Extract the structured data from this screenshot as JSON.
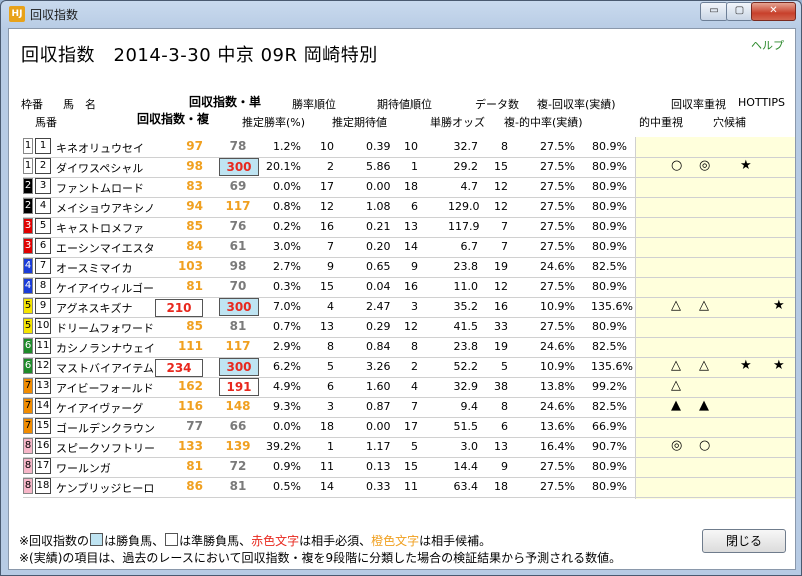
{
  "window": {
    "title": "回収指数",
    "icon_text": "HJ",
    "min": "▭",
    "max": "▢",
    "close": "✕"
  },
  "main": {
    "title": "回収指数　2014-3-30 中京 09R 岡崎特別",
    "help": "ヘルプ"
  },
  "headers_top": {
    "waku_label": "枠番",
    "horse_label": "馬　名",
    "index_single": "回収指数・単",
    "win_rank": "勝率順位",
    "exp_rank": "期待値順位",
    "data_count": "データ数",
    "place_recovery": "複-回収率(実績)",
    "recovery_focus": "回収率重視",
    "hottips": "HOTTIPS"
  },
  "headers_bottom": {
    "umaban": "馬番",
    "index_double": "回収指数・複",
    "est_win": "推定勝率(%)",
    "est_exp": "推定期待値",
    "win_odds": "単勝オッズ",
    "place_hit": "複-的中率(実績)",
    "hit_focus": "的中重視",
    "longshot": "穴候補"
  },
  "colors": {
    "orange": "#f0a020",
    "red": "#e8281e",
    "gray": "#7a7a7a",
    "cyan": "#bfe4f2"
  },
  "rows": [
    {
      "waku": "1",
      "waku_bg": "#ffffff",
      "waku_fg": "#000",
      "uma": "1",
      "name": "キネオリュウセイ",
      "i1": "97",
      "c1": "orange",
      "i2": "78",
      "c2": "gray",
      "box": "",
      "win": "1.2%",
      "wr": "10",
      "exp": "0.39",
      "er": "10",
      "odds": "32.7",
      "dc": "8",
      "hit": "27.5%",
      "rec": "80.9%",
      "m1": "",
      "m2": "",
      "m3": "",
      "m4": ""
    },
    {
      "waku": "1",
      "waku_bg": "#ffffff",
      "waku_fg": "#000",
      "uma": "2",
      "name": "ダイワスペシャル",
      "i1": "98",
      "c1": "orange",
      "i2": "300",
      "c2": "red",
      "box": "cyan",
      "win": "20.1%",
      "wr": "2",
      "exp": "5.86",
      "er": "1",
      "odds": "29.2",
      "dc": "15",
      "hit": "27.5%",
      "rec": "80.9%",
      "m1": "○",
      "m2": "◎",
      "m3": "★",
      "m4": ""
    },
    {
      "waku": "2",
      "waku_bg": "#000000",
      "waku_fg": "#fff",
      "uma": "3",
      "name": "ファントムロード",
      "i1": "83",
      "c1": "orange",
      "i2": "69",
      "c2": "gray",
      "box": "",
      "win": "0.0%",
      "wr": "17",
      "exp": "0.00",
      "er": "18",
      "odds": "4.7",
      "dc": "12",
      "hit": "27.5%",
      "rec": "80.9%",
      "m1": "",
      "m2": "",
      "m3": "",
      "m4": ""
    },
    {
      "waku": "2",
      "waku_bg": "#000000",
      "waku_fg": "#fff",
      "uma": "4",
      "name": "メイショウアキシノ",
      "i1": "94",
      "c1": "orange",
      "i2": "117",
      "c2": "orange",
      "box": "",
      "win": "0.8%",
      "wr": "12",
      "exp": "1.08",
      "er": "6",
      "odds": "129.0",
      "dc": "12",
      "hit": "27.5%",
      "rec": "80.9%",
      "m1": "",
      "m2": "",
      "m3": "",
      "m4": ""
    },
    {
      "waku": "3",
      "waku_bg": "#e00000",
      "waku_fg": "#fff",
      "uma": "5",
      "name": "キャストロメファ",
      "i1": "85",
      "c1": "orange",
      "i2": "76",
      "c2": "gray",
      "box": "",
      "win": "0.2%",
      "wr": "16",
      "exp": "0.21",
      "er": "13",
      "odds": "117.9",
      "dc": "7",
      "hit": "27.5%",
      "rec": "80.9%",
      "m1": "",
      "m2": "",
      "m3": "",
      "m4": ""
    },
    {
      "waku": "3",
      "waku_bg": "#e00000",
      "waku_fg": "#fff",
      "uma": "6",
      "name": "エーシンマイエスタ",
      "i1": "84",
      "c1": "orange",
      "i2": "61",
      "c2": "gray",
      "box": "",
      "win": "3.0%",
      "wr": "7",
      "exp": "0.20",
      "er": "14",
      "odds": "6.7",
      "dc": "7",
      "hit": "27.5%",
      "rec": "80.9%",
      "m1": "",
      "m2": "",
      "m3": "",
      "m4": ""
    },
    {
      "waku": "4",
      "waku_bg": "#1a3cd8",
      "waku_fg": "#fff",
      "uma": "7",
      "name": "オースミマイカ",
      "i1": "103",
      "c1": "orange",
      "i2": "98",
      "c2": "gray",
      "box": "",
      "win": "2.7%",
      "wr": "9",
      "exp": "0.65",
      "er": "9",
      "odds": "23.8",
      "dc": "19",
      "hit": "24.6%",
      "rec": "82.5%",
      "m1": "",
      "m2": "",
      "m3": "",
      "m4": ""
    },
    {
      "waku": "4",
      "waku_bg": "#1a3cd8",
      "waku_fg": "#fff",
      "uma": "8",
      "name": "ケイアイウィルゴー",
      "i1": "81",
      "c1": "orange",
      "i2": "70",
      "c2": "gray",
      "box": "",
      "win": "0.3%",
      "wr": "15",
      "exp": "0.04",
      "er": "16",
      "odds": "11.0",
      "dc": "12",
      "hit": "27.5%",
      "rec": "80.9%",
      "m1": "",
      "m2": "",
      "m3": "",
      "m4": ""
    },
    {
      "waku": "5",
      "waku_bg": "#f5e400",
      "waku_fg": "#000",
      "uma": "9",
      "name": "アグネスキズナ",
      "i1": "210",
      "c1": "red",
      "i2": "300",
      "c2": "red",
      "box": "both",
      "win": "7.0%",
      "wr": "4",
      "exp": "2.47",
      "er": "3",
      "odds": "35.2",
      "dc": "16",
      "hit": "10.9%",
      "rec": "135.6%",
      "m1": "△",
      "m2": "△",
      "m3": "",
      "m4": "★"
    },
    {
      "waku": "5",
      "waku_bg": "#f5e400",
      "waku_fg": "#000",
      "uma": "10",
      "name": "ドリームフォワード",
      "i1": "85",
      "c1": "orange",
      "i2": "81",
      "c2": "gray",
      "box": "",
      "win": "0.7%",
      "wr": "13",
      "exp": "0.29",
      "er": "12",
      "odds": "41.5",
      "dc": "33",
      "hit": "27.5%",
      "rec": "80.9%",
      "m1": "",
      "m2": "",
      "m3": "",
      "m4": ""
    },
    {
      "waku": "6",
      "waku_bg": "#1f8a2a",
      "waku_fg": "#fff",
      "uma": "11",
      "name": "カシノランナウェイ",
      "i1": "111",
      "c1": "orange",
      "i2": "117",
      "c2": "orange",
      "box": "",
      "win": "2.9%",
      "wr": "8",
      "exp": "0.84",
      "er": "8",
      "odds": "23.8",
      "dc": "19",
      "hit": "24.6%",
      "rec": "82.5%",
      "m1": "",
      "m2": "",
      "m3": "",
      "m4": ""
    },
    {
      "waku": "6",
      "waku_bg": "#1f8a2a",
      "waku_fg": "#fff",
      "uma": "12",
      "name": "マストバイアイテム",
      "i1": "234",
      "c1": "red",
      "i2": "300",
      "c2": "red",
      "box": "both",
      "win": "6.2%",
      "wr": "5",
      "exp": "3.26",
      "er": "2",
      "odds": "52.2",
      "dc": "5",
      "hit": "10.9%",
      "rec": "135.6%",
      "m1": "△",
      "m2": "△",
      "m3": "★",
      "m4": "★"
    },
    {
      "waku": "7",
      "waku_bg": "#f28c00",
      "waku_fg": "#000",
      "uma": "13",
      "name": "アイビーフォールド",
      "i1": "162",
      "c1": "orange",
      "i2": "191",
      "c2": "red",
      "box": "white",
      "win": "4.9%",
      "wr": "6",
      "exp": "1.60",
      "er": "4",
      "odds": "32.9",
      "dc": "38",
      "hit": "13.8%",
      "rec": "99.2%",
      "m1": "△",
      "m2": "",
      "m3": "",
      "m4": ""
    },
    {
      "waku": "7",
      "waku_bg": "#f28c00",
      "waku_fg": "#000",
      "uma": "14",
      "name": "ケイアイヴァーグ",
      "i1": "116",
      "c1": "orange",
      "i2": "148",
      "c2": "orange",
      "box": "",
      "win": "9.3%",
      "wr": "3",
      "exp": "0.87",
      "er": "7",
      "odds": "9.4",
      "dc": "8",
      "hit": "24.6%",
      "rec": "82.5%",
      "m1": "▲",
      "m2": "▲",
      "m3": "",
      "m4": ""
    },
    {
      "waku": "7",
      "waku_bg": "#f28c00",
      "waku_fg": "#000",
      "uma": "15",
      "name": "ゴールデンクラウン",
      "i1": "77",
      "c1": "gray",
      "i2": "66",
      "c2": "gray",
      "box": "",
      "win": "0.0%",
      "wr": "18",
      "exp": "0.00",
      "er": "17",
      "odds": "51.5",
      "dc": "6",
      "hit": "13.6%",
      "rec": "66.9%",
      "m1": "",
      "m2": "",
      "m3": "",
      "m4": ""
    },
    {
      "waku": "8",
      "waku_bg": "#f7b6c8",
      "waku_fg": "#000",
      "uma": "16",
      "name": "スピークソフトリー",
      "i1": "133",
      "c1": "orange",
      "i2": "139",
      "c2": "orange",
      "box": "",
      "win": "39.2%",
      "wr": "1",
      "exp": "1.17",
      "er": "5",
      "odds": "3.0",
      "dc": "13",
      "hit": "16.4%",
      "rec": "90.7%",
      "m1": "◎",
      "m2": "○",
      "m3": "",
      "m4": ""
    },
    {
      "waku": "8",
      "waku_bg": "#f7b6c8",
      "waku_fg": "#000",
      "uma": "17",
      "name": "ワールンガ",
      "i1": "81",
      "c1": "orange",
      "i2": "72",
      "c2": "gray",
      "box": "",
      "win": "0.9%",
      "wr": "11",
      "exp": "0.13",
      "er": "15",
      "odds": "14.4",
      "dc": "9",
      "hit": "27.5%",
      "rec": "80.9%",
      "m1": "",
      "m2": "",
      "m3": "",
      "m4": ""
    },
    {
      "waku": "8",
      "waku_bg": "#f7b6c8",
      "waku_fg": "#000",
      "uma": "18",
      "name": "ケンブリッジヒーロ",
      "i1": "86",
      "c1": "orange",
      "i2": "81",
      "c2": "gray",
      "box": "",
      "win": "0.5%",
      "wr": "14",
      "exp": "0.33",
      "er": "11",
      "odds": "63.4",
      "dc": "18",
      "hit": "27.5%",
      "rec": "80.9%",
      "m1": "",
      "m2": "",
      "m3": "",
      "m4": ""
    }
  ],
  "footer": {
    "l1_a": "※回収指数の",
    "l1_b": "は勝負馬、",
    "l1_c": "は準勝負馬、",
    "l1_red": "赤色文字",
    "l1_d": "は相手必須、",
    "l1_orange": "橙色文字",
    "l1_e": "は相手候補。",
    "l2": "※(実績)の項目は、過去のレースにおいて回収指数・複を9段階に分類した場合の検証結果から予測される数値。"
  },
  "close_button": "閉じる"
}
